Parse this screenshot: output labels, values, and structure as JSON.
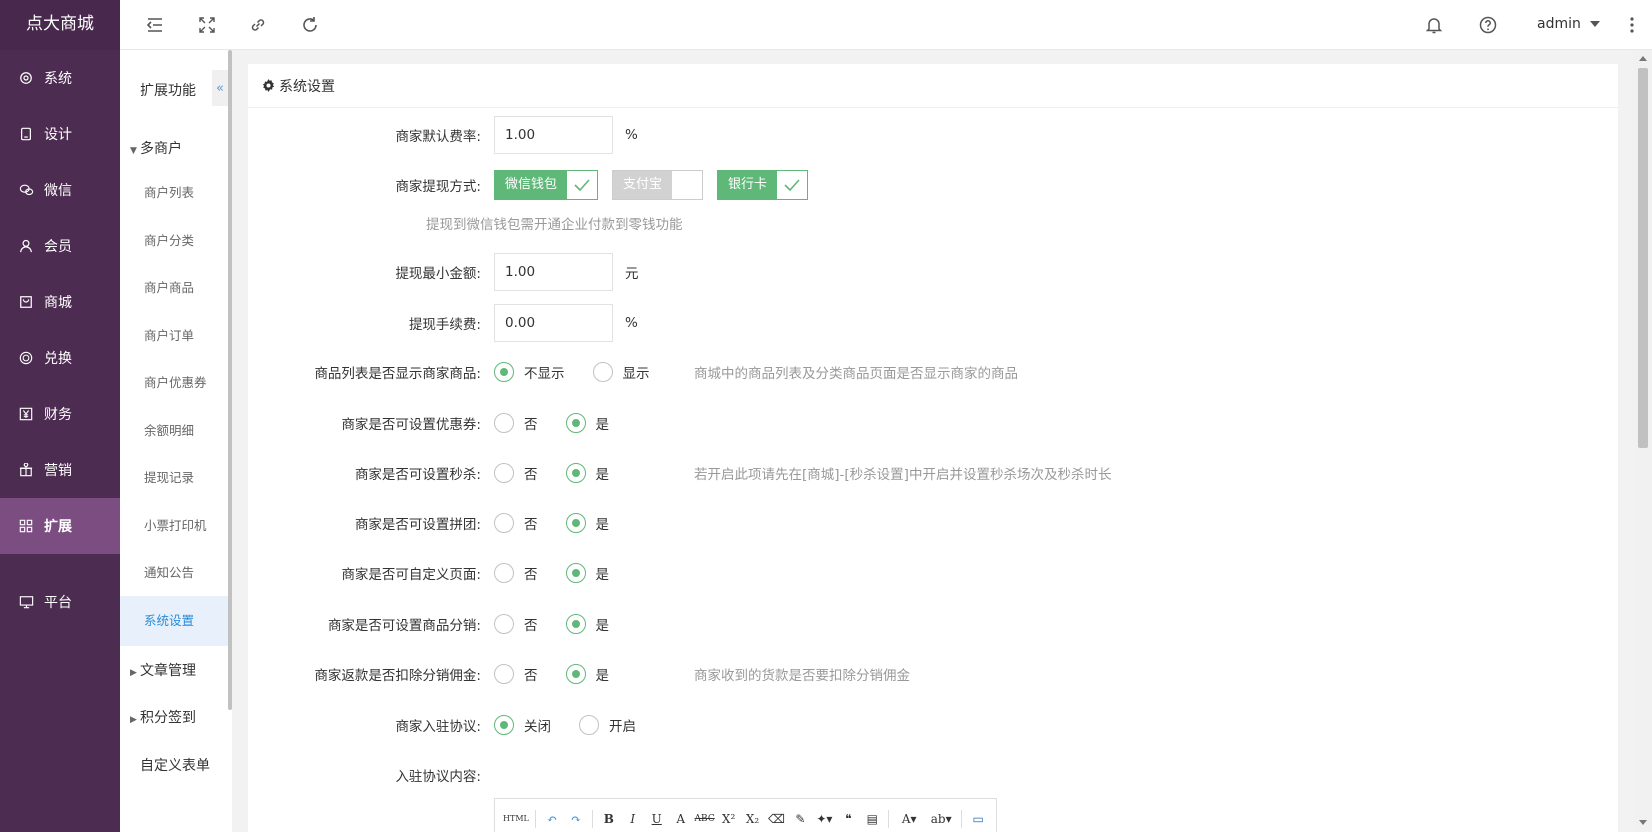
{
  "app": {
    "logo": "点大商城"
  },
  "leftnav": [
    {
      "label": "系统",
      "icon": "gear-icon",
      "active": false
    },
    {
      "label": "设计",
      "icon": "tablet-icon",
      "active": false
    },
    {
      "label": "微信",
      "icon": "wechat-icon",
      "active": false
    },
    {
      "label": "会员",
      "icon": "user-icon",
      "active": false
    },
    {
      "label": "商城",
      "icon": "shop-icon",
      "active": false
    },
    {
      "label": "兑换",
      "icon": "coin-icon",
      "active": false
    },
    {
      "label": "财务",
      "icon": "yen-icon",
      "active": false
    },
    {
      "label": "营销",
      "icon": "gift-icon",
      "active": false
    },
    {
      "label": "扩展",
      "icon": "grid-icon",
      "active": true
    },
    {
      "label": "平台",
      "icon": "monitor-icon",
      "active": false
    }
  ],
  "topbar": {
    "user": "admin"
  },
  "subnav": {
    "title": "扩展功能",
    "collapse_label": "«",
    "groups": [
      {
        "label": "多商户"
      },
      {
        "label": "文章管理"
      },
      {
        "label": "积分签到"
      },
      {
        "label": "自定义表单"
      }
    ],
    "items": [
      "商户列表",
      "商户分类",
      "商户商品",
      "商户订单",
      "商户优惠券",
      "余额明细",
      "提现记录",
      "小票打印机",
      "通知公告",
      "系统设置"
    ]
  },
  "panel": {
    "title": "系统设置"
  },
  "form": {
    "fee_rate": {
      "label": "商家默认费率:",
      "value": "1.00",
      "unit": "%"
    },
    "withdraw_methods": {
      "label": "商家提现方式:",
      "options": [
        {
          "label": "微信钱包",
          "on": true
        },
        {
          "label": "支付宝",
          "on": false
        },
        {
          "label": "银行卡",
          "on": true
        }
      ],
      "help": "提现到微信钱包需开通企业付款到零钱功能"
    },
    "min_withdraw": {
      "label": "提现最小金额:",
      "value": "1.00",
      "unit": "元"
    },
    "withdraw_fee": {
      "label": "提现手续费:",
      "value": "0.00",
      "unit": "%"
    },
    "show_products": {
      "label": "商品列表是否显示商家商品:",
      "options": [
        "不显示",
        "显示"
      ],
      "selected": 0,
      "tip": "商城中的商品列表及分类商品页面是否显示商家的商品"
    },
    "coupons": {
      "label": "商家是否可设置优惠券:",
      "options": [
        "否",
        "是"
      ],
      "selected": 1
    },
    "seckill": {
      "label": "商家是否可设置秒杀:",
      "options": [
        "否",
        "是"
      ],
      "selected": 1,
      "tip": "若开启此项请先在[商城]-[秒杀设置]中开启并设置秒杀场次及秒杀时长"
    },
    "groupbuy": {
      "label": "商家是否可设置拼团:",
      "options": [
        "否",
        "是"
      ],
      "selected": 1
    },
    "custom_page": {
      "label": "商家是否可自定义页面:",
      "options": [
        "否",
        "是"
      ],
      "selected": 1
    },
    "distribution": {
      "label": "商家是否可设置商品分销:",
      "options": [
        "否",
        "是"
      ],
      "selected": 1
    },
    "deduct_commission": {
      "label": "商家返款是否扣除分销佣金:",
      "options": [
        "否",
        "是"
      ],
      "selected": 1,
      "tip": "商家收到的货款是否要扣除分销佣金"
    },
    "agreement": {
      "label": "商家入驻协议:",
      "options": [
        "关闭",
        "开启"
      ],
      "selected": 0
    },
    "agreement_content": {
      "label": "入驻协议内容:"
    }
  },
  "editor": {
    "buttons": [
      {
        "name": "html-source-button",
        "text": "HTML"
      },
      {
        "name": "undo-button",
        "text": "↶"
      },
      {
        "name": "redo-button",
        "text": "↷"
      },
      {
        "name": "bold-button",
        "text": "B"
      },
      {
        "name": "italic-button",
        "text": "I"
      },
      {
        "name": "underline-button",
        "text": "U"
      },
      {
        "name": "font-border-button",
        "text": "A"
      },
      {
        "name": "strikethrough-button",
        "text": "ABC"
      },
      {
        "name": "superscript-button",
        "text": "X²"
      },
      {
        "name": "subscript-button",
        "text": "X₂"
      },
      {
        "name": "eraser-button",
        "text": "⌫"
      },
      {
        "name": "format-brush-button",
        "text": "✎"
      },
      {
        "name": "auto-format-button",
        "text": "✦▾"
      },
      {
        "name": "quote-button",
        "text": "❝"
      },
      {
        "name": "paste-text-button",
        "text": "▤"
      },
      {
        "name": "font-color-button",
        "text": "A▾"
      },
      {
        "name": "highlight-button",
        "text": "ab▾"
      },
      {
        "name": "preview-button",
        "text": "▭"
      }
    ]
  }
}
